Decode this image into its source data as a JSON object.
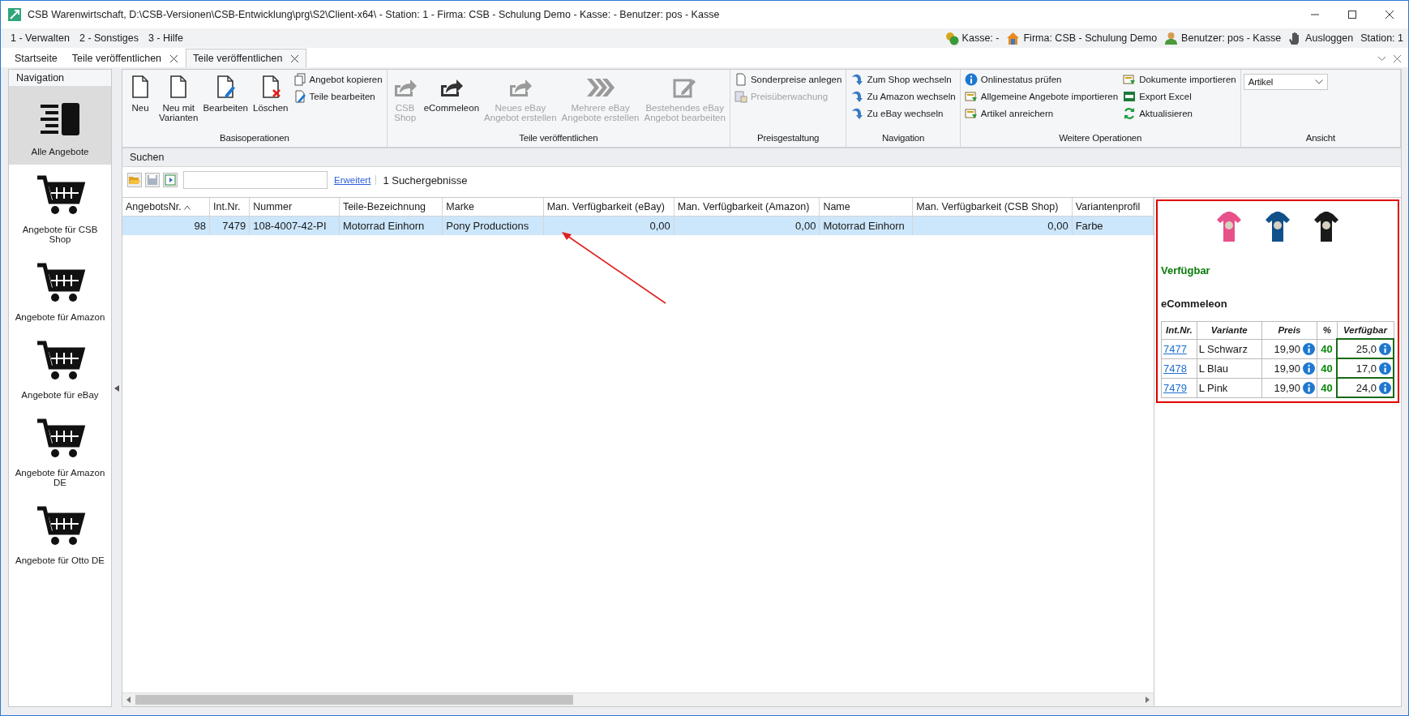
{
  "window": {
    "title": "CSB Warenwirtschaft, D:\\CSB-Versionen\\CSB-Entwicklung\\prg\\S2\\Client-x64\\ - Station: 1 - Firma: CSB - Schulung Demo - Kasse:  - Benutzer: pos - Kasse"
  },
  "menu": [
    "1 - Verwalten",
    "2 - Sonstiges",
    "3 - Hilfe"
  ],
  "status": [
    "Kasse: -",
    "Firma: CSB - Schulung Demo",
    "Benutzer: pos - Kasse",
    "Ausloggen",
    "Station: 1"
  ],
  "tabs": [
    {
      "label": "Startseite",
      "selected": false,
      "closable": false
    },
    {
      "label": "Teile veröffentlichen",
      "selected": false,
      "closable": true
    },
    {
      "label": "Teile veröffentlichen",
      "selected": true,
      "closable": true
    }
  ],
  "navigation": {
    "title": "Navigation",
    "items": [
      {
        "label": "Alle Angebote",
        "selected": true
      },
      {
        "label": "Angebote für CSB Shop",
        "selected": false
      },
      {
        "label": "Angebote für Amazon",
        "selected": false
      },
      {
        "label": "Angebote für eBay",
        "selected": false
      },
      {
        "label": "Angebote für Amazon DE",
        "selected": false
      },
      {
        "label": "Angebote für Otto DE",
        "selected": false
      }
    ]
  },
  "ribbon": [
    {
      "label": "Basisoperationen",
      "columns": [
        {
          "kind": "large",
          "label": "Neu",
          "disabled": false
        },
        {
          "kind": "large",
          "label": "Neu mit\nVarianten",
          "disabled": false
        },
        {
          "kind": "large",
          "label": "Bearbeiten",
          "disabled": false
        },
        {
          "kind": "large",
          "label": "Löschen",
          "disabled": false
        },
        {
          "kind": "stack",
          "items": [
            {
              "label": "Angebot kopieren",
              "disabled": false
            },
            {
              "label": "Teile bearbeiten",
              "disabled": false
            }
          ]
        }
      ]
    },
    {
      "label": "Teile veröffentlichen",
      "columns": [
        {
          "kind": "large",
          "label": "CSB\nShop",
          "disabled": true
        },
        {
          "kind": "large",
          "label": "eCommeleon",
          "disabled": false
        },
        {
          "kind": "large",
          "label": "Neues eBay\nAngebot erstellen",
          "disabled": true
        },
        {
          "kind": "large",
          "label": "Mehrere eBay\nAngebote erstellen",
          "disabled": true
        },
        {
          "kind": "large",
          "label": "Bestehendes eBay\nAngebot bearbeiten",
          "disabled": true
        }
      ]
    },
    {
      "label": "Preisgestaltung",
      "columns": [
        {
          "kind": "stack",
          "items": [
            {
              "label": "Sonderpreise anlegen",
              "disabled": false
            },
            {
              "label": "Preisüberwachung",
              "disabled": true
            }
          ]
        }
      ]
    },
    {
      "label": "Navigation",
      "columns": [
        {
          "kind": "stack",
          "items": [
            {
              "label": "Zum Shop wechseln",
              "disabled": false
            },
            {
              "label": "Zu Amazon wechseln",
              "disabled": false
            },
            {
              "label": "Zu eBay wechseln",
              "disabled": false
            }
          ]
        }
      ]
    },
    {
      "label": "Weitere Operationen",
      "columns": [
        {
          "kind": "stack",
          "items": [
            {
              "label": "Onlinestatus prüfen",
              "disabled": false
            },
            {
              "label": "Allgemeine Angebote importieren",
              "disabled": false
            },
            {
              "label": "Artikel anreichern",
              "disabled": false
            }
          ]
        },
        {
          "kind": "stack",
          "items": [
            {
              "label": "Dokumente importieren",
              "disabled": false
            },
            {
              "label": "Export Excel",
              "disabled": false
            },
            {
              "label": "Aktualisieren",
              "disabled": false
            }
          ]
        }
      ]
    },
    {
      "label": "Ansicht",
      "columns": [
        {
          "kind": "dropdown",
          "value": "Artikel"
        }
      ]
    }
  ],
  "search": {
    "title": "Suchen",
    "link": "Erweitert",
    "result": "1 Suchergebnisse"
  },
  "table": {
    "columns": [
      {
        "label": "AngebotsNr.",
        "kind": "number",
        "sorted": true
      },
      {
        "label": "Int.Nr.",
        "kind": "number",
        "sorted": false
      },
      {
        "label": "Nummer",
        "kind": "text",
        "sorted": false
      },
      {
        "label": "Teile-Bezeichnung",
        "kind": "text",
        "sorted": false
      },
      {
        "label": "Marke",
        "kind": "text",
        "sorted": false
      },
      {
        "label": "Man. Verfügbarkeit (eBay)",
        "kind": "number",
        "sorted": false
      },
      {
        "label": "Man. Verfügbarkeit (Amazon)",
        "kind": "number",
        "sorted": false
      },
      {
        "label": "Name",
        "kind": "text",
        "sorted": false
      },
      {
        "label": "Man. Verfügbarkeit (CSB Shop)",
        "kind": "number",
        "sorted": false
      },
      {
        "label": "Variantenprofil",
        "kind": "text",
        "sorted": false
      }
    ],
    "rows": [
      {
        "selected": true,
        "cells": [
          "98",
          "7479",
          "108-4007-42-PI",
          "Motorrad Einhorn",
          "Pony Productions",
          "0,00",
          "0,00",
          "Motorrad Einhorn",
          "0,00",
          "Farbe"
        ]
      }
    ]
  },
  "detail": {
    "images": [
      {
        "color": "#e8508a"
      },
      {
        "color": "#10508a"
      },
      {
        "color": "#1a1a1a"
      }
    ],
    "status": "Verfügbar",
    "channel": "eCommeleon",
    "columns": [
      "Int.Nr.",
      "Variante",
      "Preis",
      "%",
      "Verfügbar"
    ],
    "rows": [
      {
        "id": "7477",
        "variant": "L Schwarz",
        "price": "19,90",
        "percent": "40",
        "available": "25,0"
      },
      {
        "id": "7478",
        "variant": "L Blau",
        "price": "19,90",
        "percent": "40",
        "available": "17,0"
      },
      {
        "id": "7479",
        "variant": "L Pink",
        "price": "19,90",
        "percent": "40",
        "available": "24,0"
      }
    ]
  }
}
